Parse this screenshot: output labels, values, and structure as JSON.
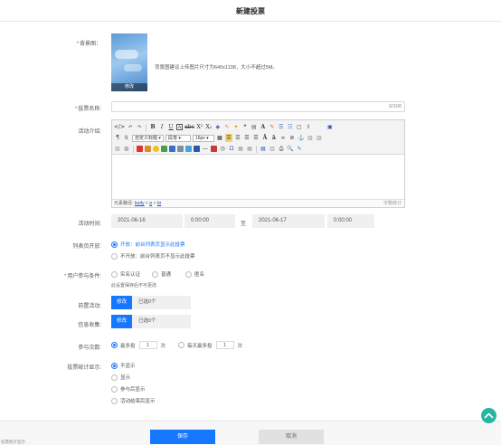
{
  "header": {
    "title": "新建投票"
  },
  "form": {
    "bg_image": {
      "label": "背景图：",
      "edit_label": "修改",
      "hint": "背景图建议上传图片尺寸为640x1138，大小不超过5M。"
    },
    "name": {
      "label": "投票名称:",
      "value": "",
      "counter": "0/100"
    },
    "intro": {
      "label": "活动介绍:",
      "toolbar": {
        "format_select": "自定义标题",
        "paragraph_select": "段落",
        "font_size_select": "16px"
      },
      "statusbar": {
        "path_label": "元素路径:",
        "path_body": "body",
        "path_p": "p",
        "path_br": "br",
        "word_count": "字数统计"
      }
    },
    "time": {
      "label": "活动时间:",
      "start_date": "2021-06-16",
      "start_time": "0:00:00",
      "to": "至",
      "end_date": "2021-06-17",
      "end_time": "0:00:00"
    },
    "list_open": {
      "label": "列表页开放:",
      "options": [
        {
          "prefix": "开放",
          "text": "开放：前台列表页显示此投票",
          "selected": true
        },
        {
          "prefix": "不开放",
          "text": "不开放：前台列表页不显示此投票",
          "selected": false
        }
      ]
    },
    "participation": {
      "label": "用户参与条件:",
      "options": [
        {
          "text": "实名认证",
          "selected": false
        },
        {
          "text": "普通",
          "selected": false
        },
        {
          "text": "匿名",
          "selected": false
        }
      ],
      "note": "此设置保存后不可更改"
    },
    "pre_activity": {
      "label": "前置活动:",
      "button": "修改",
      "value": "已选0个"
    },
    "info_collect": {
      "label": "信息收集:",
      "button": "修改",
      "value": "已选0个"
    },
    "vote_count": {
      "label": "参与次数:",
      "options": [
        {
          "pre": "最多投",
          "value": "1",
          "post": "次",
          "selected": true
        },
        {
          "pre": "每天最多投",
          "value": "1",
          "post": "次",
          "selected": false
        }
      ]
    },
    "stats_display": {
      "label": "投票统计显示:",
      "options": [
        {
          "text": "不显示",
          "selected": true
        },
        {
          "text": "显示",
          "selected": false
        },
        {
          "text": "参与后显示",
          "selected": false
        },
        {
          "text": "活动结束后显示",
          "selected": false
        }
      ]
    }
  },
  "footer": {
    "save": "保存",
    "cancel": "取消",
    "note": "投票统计显示"
  },
  "colors": {
    "primary": "#1677ff",
    "required": "#e53935",
    "scroll_top": "#27b5a0"
  }
}
